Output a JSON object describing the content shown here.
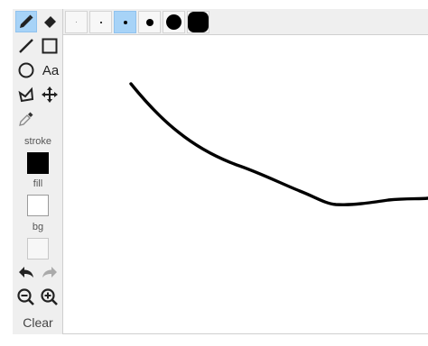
{
  "toolbar": {
    "tools": [
      {
        "name": "pencil-icon",
        "selected": true
      },
      {
        "name": "eraser-icon",
        "selected": false
      },
      {
        "name": "line-icon",
        "selected": false
      },
      {
        "name": "rectangle-icon",
        "selected": false
      },
      {
        "name": "ellipse-icon",
        "selected": false
      },
      {
        "name": "text-tool-icon",
        "selected": false
      },
      {
        "name": "polygon-icon",
        "selected": false
      },
      {
        "name": "move-icon",
        "selected": false
      },
      {
        "name": "eyedropper-icon",
        "selected": false
      }
    ],
    "text_tool_label": "Aa",
    "stroke_label": "stroke",
    "fill_label": "fill",
    "bg_label": "bg",
    "stroke_color": "#000000",
    "fill_color": "#ffffff",
    "bg_color": "#f7f7f7",
    "undo_icon": "undo-icon",
    "redo_icon": "redo-icon",
    "zoom_out_icon": "zoom-out-icon",
    "zoom_in_icon": "zoom-in-icon",
    "clear_label": "Clear"
  },
  "brush_sizes": {
    "options": [
      "size-1",
      "size-2",
      "size-3",
      "size-4",
      "size-5",
      "size-6"
    ],
    "selected_index": 2
  },
  "colors": {
    "selection": "#a7d3f7",
    "toolbar_bg": "#efefef",
    "stroke": "#000000"
  }
}
